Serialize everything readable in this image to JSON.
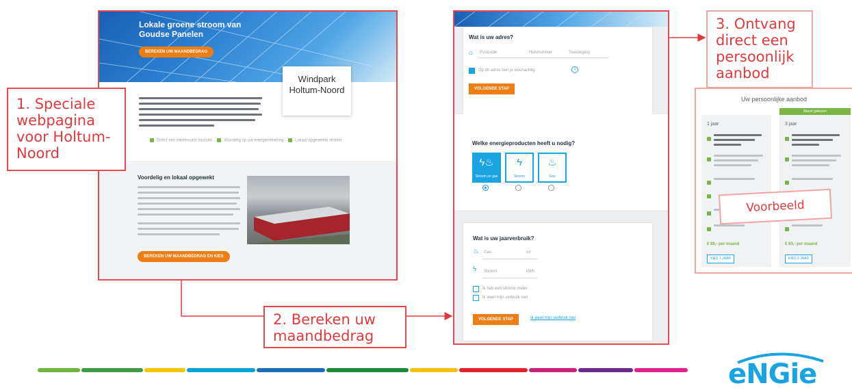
{
  "steps": {
    "step1": "1. Speciale webpagina voor Holtum-Noord",
    "step2": "2. Bereken uw maandbedrag",
    "step3": "3. Ontvang direct een persoonlijk aanbod"
  },
  "webpage": {
    "hero_title": "Lokale groene stroom van Goudse Panelen",
    "hero_button": "BEREKEN UW MAANDBEDRAG",
    "windpark_card": "Windpark Holtum-Noord",
    "bullets": [
      "Direct een interessant voorstel",
      "Voordelig op uw energierekening",
      "Lokaal opgewekte stroom"
    ],
    "section_title": "Voordelig en lokaal opgewekt",
    "section_button": "BEREKEN UW MAANDBEDRAG EN KIES"
  },
  "form": {
    "address_question": "Wat is uw adres?",
    "address_fields": [
      "Postcode",
      "Huisnummer",
      "Toevoeging"
    ],
    "address_check": "Op dit adres ben je woonachtig",
    "next_button": "VOLGENDE STAP",
    "products_question": "Welke energieproducten heeft u nodig?",
    "products": [
      {
        "label": "Stroom en gas",
        "icon": "bolt-flame-icon"
      },
      {
        "label": "Stroom",
        "icon": "bolt-icon"
      },
      {
        "label": "Gas",
        "icon": "flame-icon"
      }
    ],
    "usage_question": "Wat is uw jaarverbruik?",
    "gas_placeholder": "Gas",
    "gas_unit": "m³",
    "power_placeholder": "Stroom",
    "power_unit": "kWh",
    "usage_checks": [
      "Ik heb een slimme meter",
      "Ik weet mijn verbruik niet"
    ],
    "calc_button": "VOLGENDE STAP",
    "calc_link": "Ik weet mijn verbruik niet"
  },
  "offer": {
    "title": "Uw persoonlijke aanbod",
    "badge": "Meest gekozen",
    "col1_header": "1 jaar",
    "col2_header": "3 jaar",
    "col1_price": "€ 89,- per maand",
    "col2_price": "€ 83,- per maand",
    "col_button": "KIES 1 JAAR",
    "col2_button": "KIES 3 JAAR",
    "stamp": "Voorbeeld"
  },
  "stripe_colors": [
    "#6fb43f",
    "#4a9a3f",
    "#0aa0d8",
    "#f5b400",
    "#0aa0d8",
    "#1b8a3c",
    "#f4c20d",
    "#e0232d",
    "#c8227a",
    "#6d2b8a",
    "#e0238a"
  ],
  "logo": "eNGie",
  "colors": {
    "accent_red": "#e8474b",
    "engie_blue": "#19a3e0",
    "cta_orange": "#ee7d13",
    "green": "#7ab543"
  }
}
